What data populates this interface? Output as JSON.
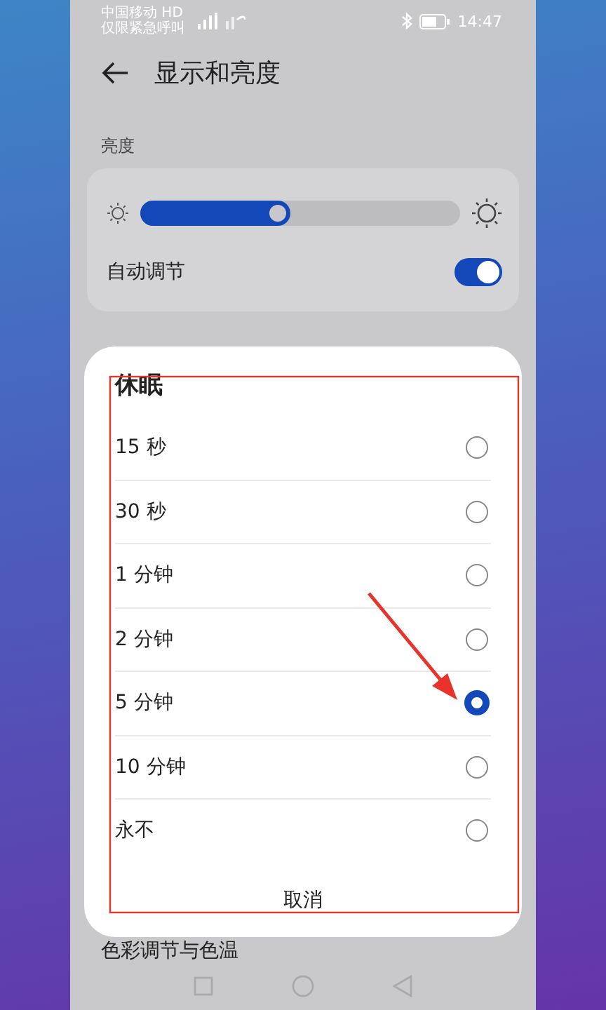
{
  "status_bar": {
    "carrier": "中国移动 HD",
    "emergency": "仅限紧急呼叫",
    "time": "14:47"
  },
  "header": {
    "title": "显示和亮度"
  },
  "brightness": {
    "label": "亮度",
    "level": 0.47,
    "auto_label": "自动调节",
    "auto_on": true
  },
  "dialog": {
    "title": "休眠",
    "options": [
      {
        "label": "15 秒",
        "selected": false
      },
      {
        "label": "30 秒",
        "selected": false
      },
      {
        "label": "1 分钟",
        "selected": false
      },
      {
        "label": "2 分钟",
        "selected": false
      },
      {
        "label": "5 分钟",
        "selected": true
      },
      {
        "label": "10 分钟",
        "selected": false
      },
      {
        "label": "永不",
        "selected": false
      }
    ],
    "cancel": "取消"
  },
  "behind_item": {
    "label": "色彩调节与色温"
  }
}
